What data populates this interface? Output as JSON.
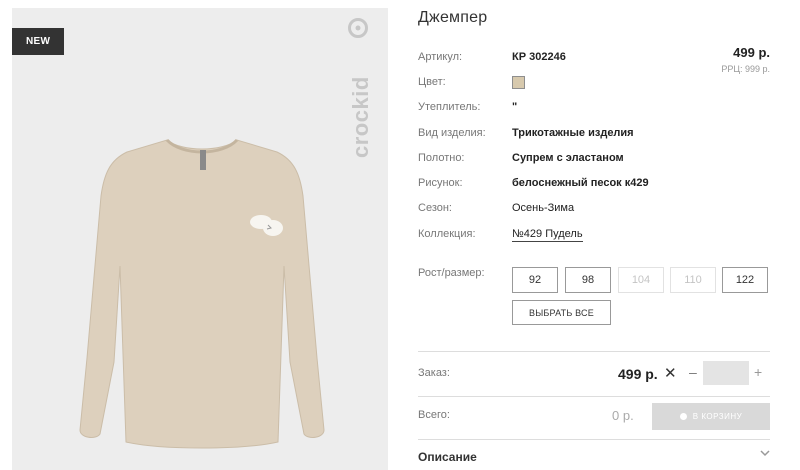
{
  "image": {
    "badge": "NEW",
    "brand": "crockid"
  },
  "product": {
    "title": "Джемпер",
    "price": "499 р.",
    "rrp": "РРЦ: 999 р.",
    "properties": [
      {
        "label": "Артикул:",
        "value": "КР 302246"
      },
      {
        "label": "Цвет:",
        "value": ""
      },
      {
        "label": "Утеплитель:",
        "value": "\""
      },
      {
        "label": "Вид изделия:",
        "value": "Трикотажные изделия"
      },
      {
        "label": "Полотно:",
        "value": "Супрем с эластаном"
      },
      {
        "label": "Рисунок:",
        "value": "белоснежный песок к429"
      },
      {
        "label": "Сезон:",
        "value": "Осень-Зима"
      },
      {
        "label": "Коллекция:",
        "value": "№429 Пудель"
      }
    ],
    "color_hex": "#d7c9ad"
  },
  "sizes": {
    "label": "Рост/размер:",
    "options": [
      {
        "value": "92",
        "available": true
      },
      {
        "value": "98",
        "available": true
      },
      {
        "value": "104",
        "available": false
      },
      {
        "value": "110",
        "available": false
      },
      {
        "value": "122",
        "available": true
      }
    ],
    "select_all_label": "ВЫБРАТЬ ВСЕ"
  },
  "order": {
    "label": "Заказ:",
    "price": "499 р.",
    "times": "✕",
    "minus": "–",
    "plus": "+",
    "quantity": ""
  },
  "total": {
    "label": "Всего:",
    "amount": "0 р.",
    "cart_label": "В КОРЗИНУ"
  },
  "description": {
    "label": "Описание"
  }
}
